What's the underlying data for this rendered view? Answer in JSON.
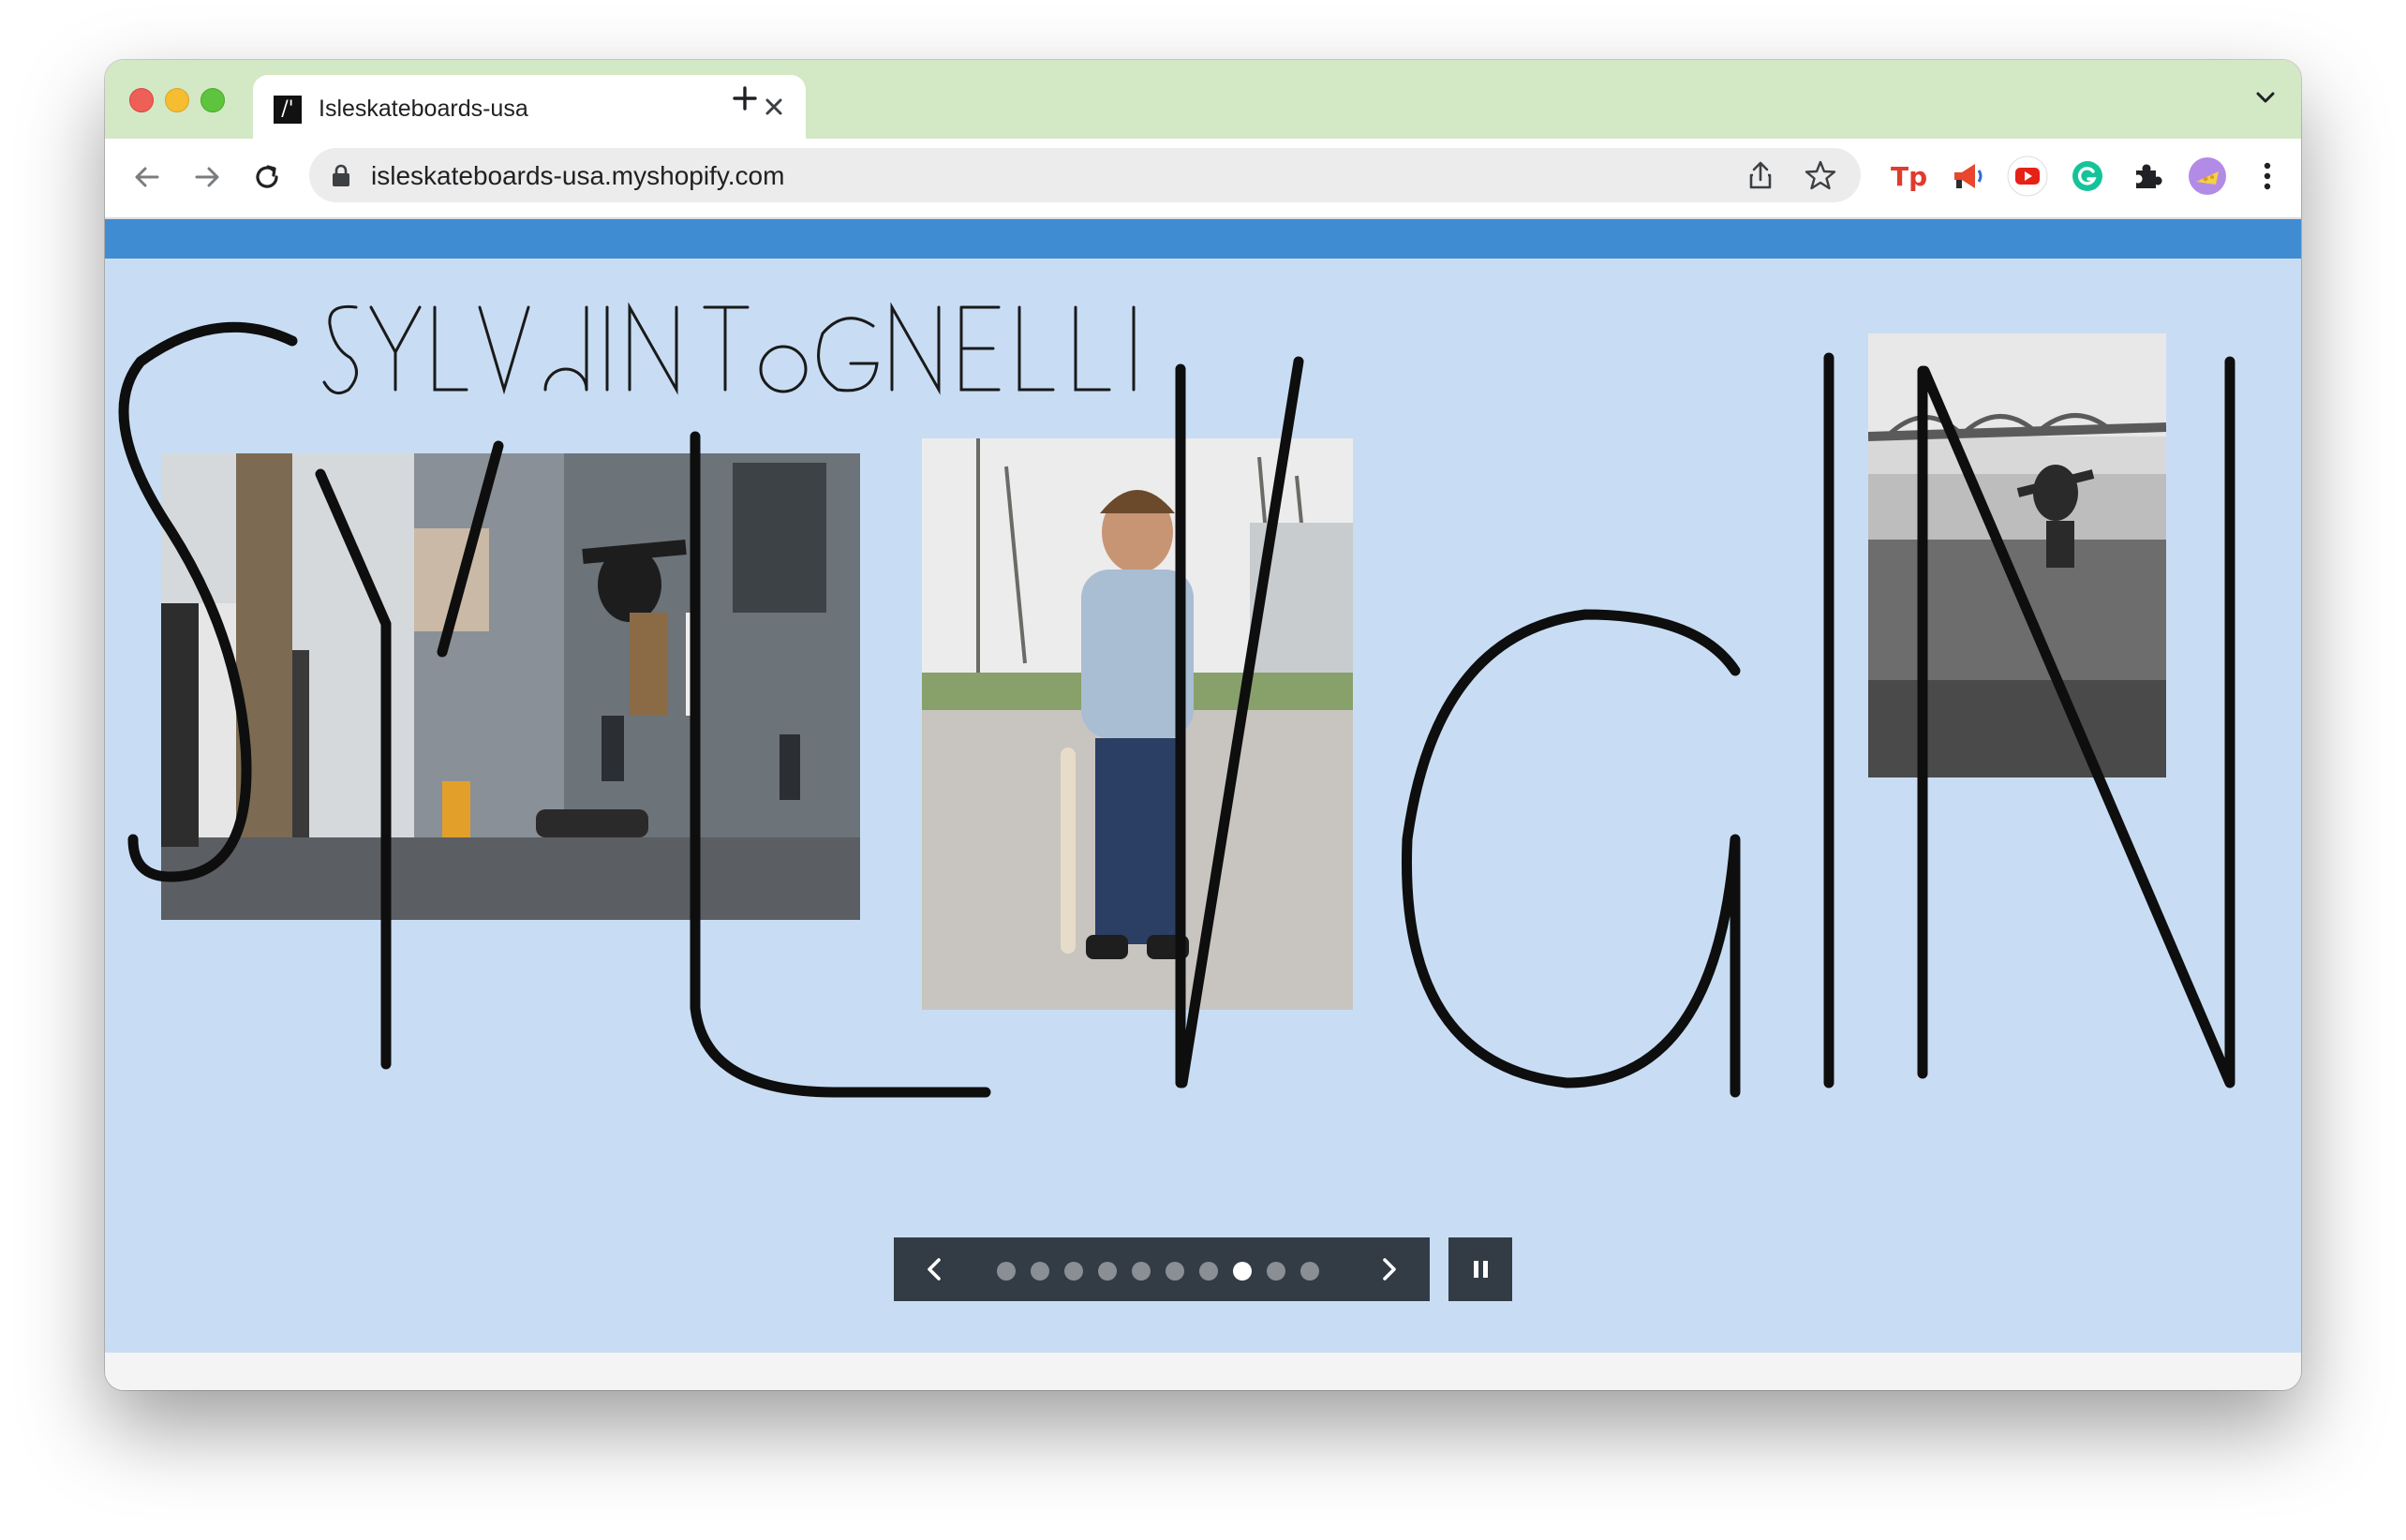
{
  "browser": {
    "tab_title": "Isleskateboards-usa",
    "url": "isleskateboards-usa.myshopify.com",
    "favicon_text": "/'",
    "toolbar_icons": [
      "back-icon",
      "forward-icon",
      "reload-icon",
      "lock-icon",
      "share-icon",
      "star-icon"
    ],
    "extensions": [
      "tp-extension",
      "megaphone-extension",
      "youtube-extension",
      "grammarly-extension",
      "puzzle-extension",
      "profile-avatar",
      "more-menu"
    ]
  },
  "colors": {
    "tabstrip": "#d3e8c4",
    "announcement_bar": "#3f8cd3",
    "hero_background": "#c8ddf4",
    "slideshow_controls": "#333c45"
  },
  "hero": {
    "headline_image": "SYLVAIN TOGNELLI",
    "wordmark_image": "Sylvain"
  },
  "slideshow": {
    "slide_count": 10,
    "active_index": 7,
    "controls": [
      "chevron-left-icon",
      "chevron-right-icon",
      "pause-icon"
    ]
  }
}
